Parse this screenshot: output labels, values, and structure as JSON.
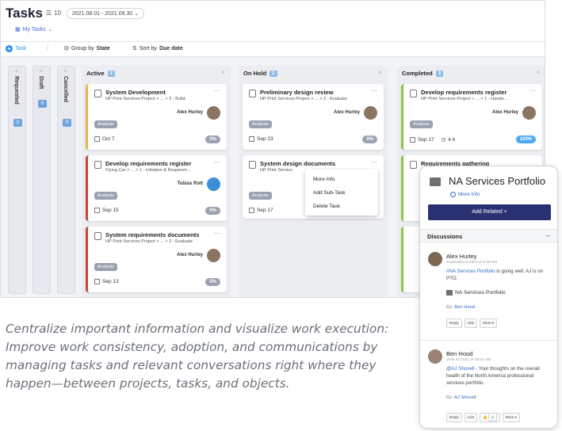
{
  "header": {
    "title": "Tasks",
    "count": "10",
    "date_range": "2021.08.01 - 2021.09.30",
    "my_tasks": "My Tasks"
  },
  "toolbar": {
    "add_task": "Task",
    "group_by_prefix": "Group by",
    "group_by_value": "State",
    "sort_by_prefix": "Sort by",
    "sort_by_value": "Due date"
  },
  "collapsed_columns": [
    {
      "label": "Requested",
      "count": "0"
    },
    {
      "label": "Draft",
      "count": "0"
    },
    {
      "label": "Cancelled",
      "count": "0"
    }
  ],
  "columns": [
    {
      "label": "Active",
      "count": "3",
      "cards": [
        {
          "name": "System Development",
          "path": "HP Print Services Project > ... > 3 - Build",
          "owner": "Alex Hurley",
          "tag": "Analysis",
          "date": "Oct 7",
          "percent": "0%",
          "color": "#e4b94a"
        },
        {
          "name": "Develop requirements register",
          "path": "Flying Car > ... > 1 - Initiation & Requirem...",
          "owner": "Tobias Rott",
          "tag": "Analysis",
          "date": "Sep 15",
          "percent": "0%",
          "color": "#c8443c"
        },
        {
          "name": "System requirements documents",
          "path": "HP Print Services Project > ... > 2 - Evaluate",
          "owner": "Alex Hurley",
          "tag": "Analysis",
          "date": "Sep 13",
          "percent": "0%",
          "color": "#c8443c"
        }
      ]
    },
    {
      "label": "On Hold",
      "count": "2",
      "cards": [
        {
          "name": "Preliminary design review",
          "path": "HP Print Services Project > ... > 2 - Evaluate",
          "owner": "Alex Hurley",
          "tag": "Analysis",
          "date": "Sep 23",
          "percent": "0%",
          "color": "#c8443c"
        },
        {
          "name": "System design documents",
          "path": "HP Print Service",
          "owner": "",
          "tag": "Analysis",
          "date": "Sep 17",
          "percent": "",
          "color": "#c8443c"
        }
      ]
    },
    {
      "label": "Completed",
      "count": "3",
      "cards": [
        {
          "name": "Develop requirements register",
          "path": "HP Print Services Project > ... > 1 - Hando...",
          "owner": "Alex Hurley",
          "tag": "Analysis",
          "date": "Sep 17",
          "hours": "4 h",
          "percent": "100%",
          "color": "#8cc63f"
        },
        {
          "name": "Requirements gathering",
          "path": "",
          "owner": "",
          "tag": "",
          "date": "",
          "percent": "",
          "color": "#8cc63f"
        }
      ]
    }
  ],
  "context_menu": {
    "items": [
      "More Info",
      "Add Sub-Task",
      "Delete Task"
    ]
  },
  "panel": {
    "title": "NA Services Portfolio",
    "more_info": "More Info",
    "add_related": "Add Related +",
    "discussions": "Discussions",
    "collapse": "–",
    "messages": [
      {
        "author": "Alex Hurley",
        "time": "September 9 2021 at 3:30 PM",
        "mention": "#NA Services Portfolio",
        "text": " is going well. AJ is on PTO.",
        "object": "NA Services Portfolio",
        "cc_label": "Cc:",
        "cc_name": "Ben Hood",
        "buttons": [
          "Reply",
          "Like",
          "More ▾"
        ]
      },
      {
        "author": "Ben Hood",
        "time": "June 10 2021 at 10:42 AM",
        "mention": "@AJ Shovell",
        "text": " - Your thoughts on the overall health of the North America professional services portfolio.",
        "cc_label": "Cc:",
        "cc_name": "AJ Shovell",
        "buttons": [
          "Reply",
          "Like",
          "1",
          "More ▾"
        ]
      }
    ]
  },
  "caption": "Centralize important information and visualize work execution: Improve work consistency, adoption, and communications by managing tasks and relevant conversations right where they happen—between projects, tasks, and objects."
}
